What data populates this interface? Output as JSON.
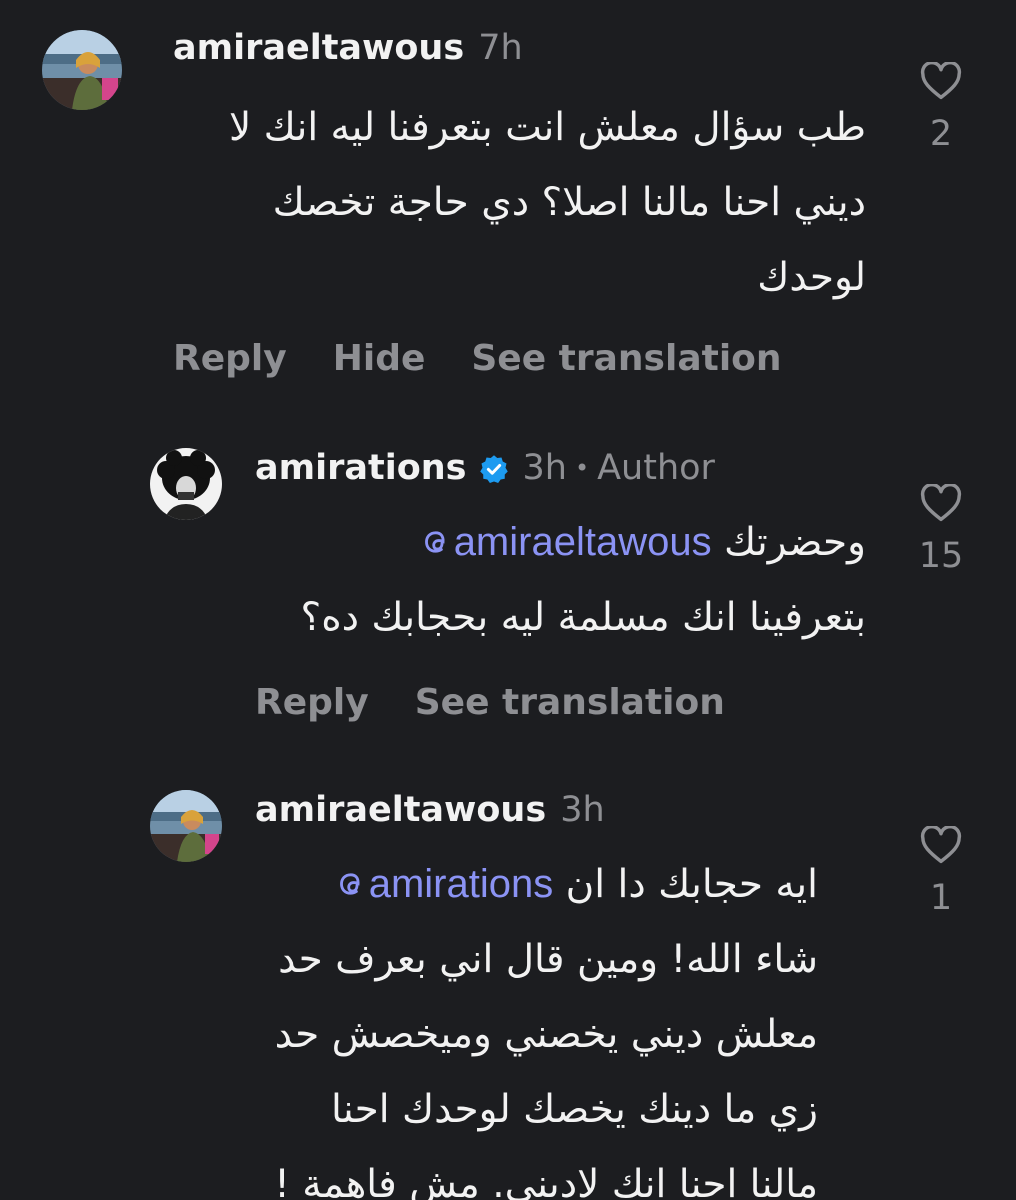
{
  "comments": [
    {
      "username": "amiraeltawous",
      "time": "7h",
      "lines": [
        "طب سؤال معلش انت بتعرفنا ليه انك لا",
        "ديني احنا مالنا اصلا؟  دي حاجة تخصك",
        "لوحدك"
      ],
      "actions": {
        "reply": "Reply",
        "hide": "Hide",
        "translate": "See translation"
      },
      "likes": "2"
    },
    {
      "username": "amirations",
      "time": "3h",
      "dot": "•",
      "badge": "Author",
      "verified": true,
      "mention": "amiraeltawous",
      "first_line_text": "وحضرتك",
      "lines": [
        "بتعرفينا انك مسلمة ليه بحجابك ده؟"
      ],
      "actions": {
        "reply": "Reply",
        "translate": "See translation"
      },
      "likes": "15"
    },
    {
      "username": "amiraeltawous",
      "time": "3h",
      "mention": "amirations",
      "first_line_text": "ايه حجابك دا ان",
      "lines": [
        "شاء الله! ومين قال اني بعرف حد",
        "معلش ديني يخصني وميخصش حد",
        "زي ما دينك يخصك لوحدك احنا",
        "مالنا احنا انك لاديني. مش فاهمة !"
      ],
      "likes": "1"
    }
  ],
  "colors": {
    "background": "#1c1d20",
    "text": "#f2f2f2",
    "muted": "#8e8f93",
    "mention": "#8b93f4",
    "verified": "#1d9bf0"
  },
  "icons": {
    "like": "heart-outline-icon",
    "verified": "verified-badge-icon",
    "mention": "threads-at-icon"
  }
}
